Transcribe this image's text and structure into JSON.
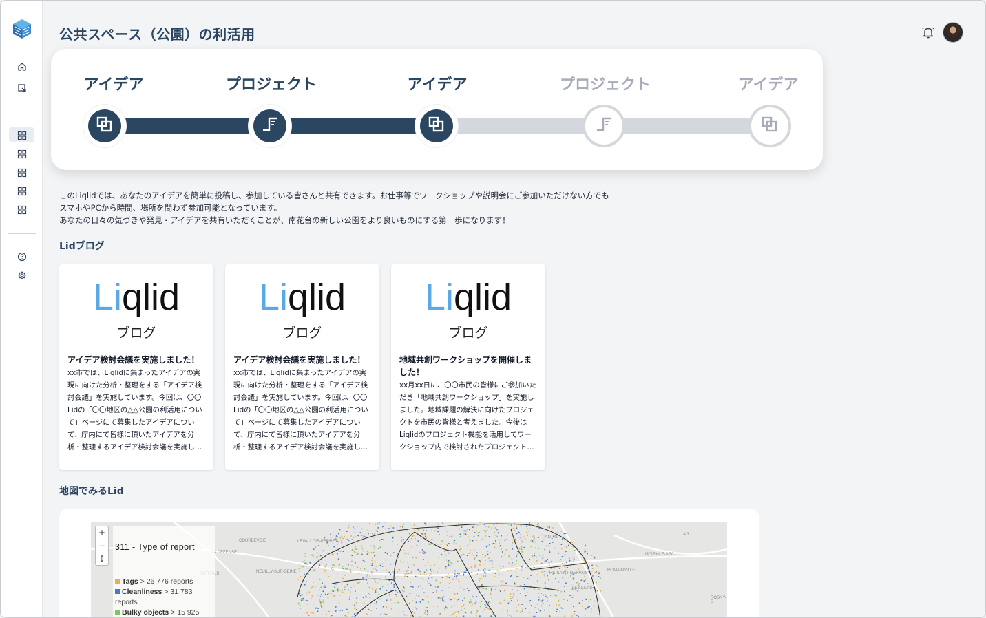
{
  "header": {
    "title": "公共スペース（公園）の利活用"
  },
  "sidebar": {
    "items": [
      {
        "icon": "home-icon"
      },
      {
        "icon": "edit-icon"
      },
      {
        "icon": "grid-icon",
        "active": true
      },
      {
        "icon": "grid-icon"
      },
      {
        "icon": "grid-icon"
      },
      {
        "icon": "grid-icon"
      },
      {
        "icon": "grid-icon"
      },
      {
        "icon": "help-icon"
      },
      {
        "icon": "gear-icon"
      }
    ]
  },
  "stepper": {
    "steps": [
      {
        "label": "アイデア",
        "state": "done",
        "icon": "idea-icon"
      },
      {
        "label": "プロジェクト",
        "state": "done",
        "icon": "project-icon"
      },
      {
        "label": "アイデア",
        "state": "done",
        "icon": "idea-icon"
      },
      {
        "label": "プロジェクト",
        "state": "todo",
        "icon": "project-icon"
      },
      {
        "label": "アイデア",
        "state": "todo",
        "icon": "idea-icon"
      }
    ],
    "colors": {
      "done": "#2b4660",
      "todo": "#d4d7dd"
    }
  },
  "intro": {
    "lines": [
      "このLiqlidでは、あなたのアイデアを簡単に投稿し、参加している皆さんと共有できます。お仕事等でワークショップや説明会にご参加いただけない方でも",
      "スマホやPCから時間、場所を問わず参加可能となっています。",
      "あなたの日々の気づきや発見・アイデアを共有いただくことが、南花台の新しい公園をより良いものにする第一歩になります！"
    ]
  },
  "blog": {
    "section_title": "Lidブログ",
    "logo_text": "Liqlid",
    "logo_sub": "ブログ",
    "cards": [
      {
        "title": "アイデア検討会議を実施しました！",
        "body": "xx市では、Liqlidに集まったアイデアの実現に向けた分析・整理をする「アイデア検討会議」を実施しています。今回は、〇〇Lidの「〇〇地区の△△公園の利活用について」ページにて募集したアイデアについて、庁内にて皆様に頂いたアイデアを分析・整理するアイデア検討会議を実施しました。"
      },
      {
        "title": "アイデア検討会議を実施しました！",
        "body": "xx市では、Liqlidに集まったアイデアの実現に向けた分析・整理をする「アイデア検討会議」を実施しています。今回は、〇〇Lidの「〇〇地区の△△公園の利活用について」ページにて募集したアイデアについて、庁内にて皆様に頂いたアイデアを分析・整理するアイデア検討会議を実施しました。"
      },
      {
        "title": "地域共創ワークショップを開催しました！",
        "body": "xx月xx日に、〇〇市民の皆様にご参加いただき「地域共創ワークショップ」を実施しました。地域課題の解決に向けたプロジェクトを市民の皆様と考えました。今後はLiqlidのプロジェクト機能を活用してワークショップ内で検討されたプロジェクトを推進していきます。"
      }
    ]
  },
  "map": {
    "section_title": "地図でみるLid",
    "zoom_in": "+",
    "zoom_out": "−",
    "compass": "⇕",
    "legend_title": "311 - Type of report",
    "legend": [
      {
        "name": "Tags",
        "text": " > 26 776 reports",
        "color": "#e8b04a"
      },
      {
        "name": "Cleanliness",
        "text": " > 31 783 reports",
        "color": "#4a78c8"
      },
      {
        "name": "Bulky objects",
        "text": " > 15 925",
        "color": "#7cc85a"
      }
    ],
    "places": [
      "COURBEVOIE",
      "LEVALLOIS-PERRET",
      "LA DÉFENSE",
      "PUTEAUX",
      "NEUILLY-SUR-SEINE",
      "PANTIN",
      "NOISY-LE-SEC",
      "ROMAINVILLE",
      "PRÉ-SAINT-GERVAIS",
      "LES LILAS",
      "ROSNY-S",
      "A 3"
    ]
  }
}
